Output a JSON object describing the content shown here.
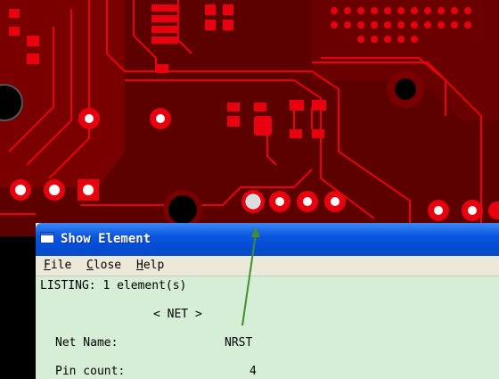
{
  "window": {
    "title": "Show Element"
  },
  "menu": [
    {
      "label": "File",
      "accel": "F",
      "rest": "ile"
    },
    {
      "label": "Close",
      "accel": "C",
      "rest": "lose"
    },
    {
      "label": "Help",
      "accel": "H",
      "rest": "elp"
    }
  ],
  "listing": {
    "header": "LISTING: 1 element(s)",
    "section": "< NET >",
    "net_name_label": "Net Name:",
    "net_name_value": "NRST",
    "pin_count_label": "Pin count:",
    "pin_count_value": "4"
  },
  "colors": {
    "board": "#5C0000",
    "copper": "#E8000E",
    "arrow": "#3F8F2F",
    "titlebar": "#0A56E0",
    "listing_bg": "#D6EED6"
  },
  "icons": [
    "window-icon"
  ]
}
